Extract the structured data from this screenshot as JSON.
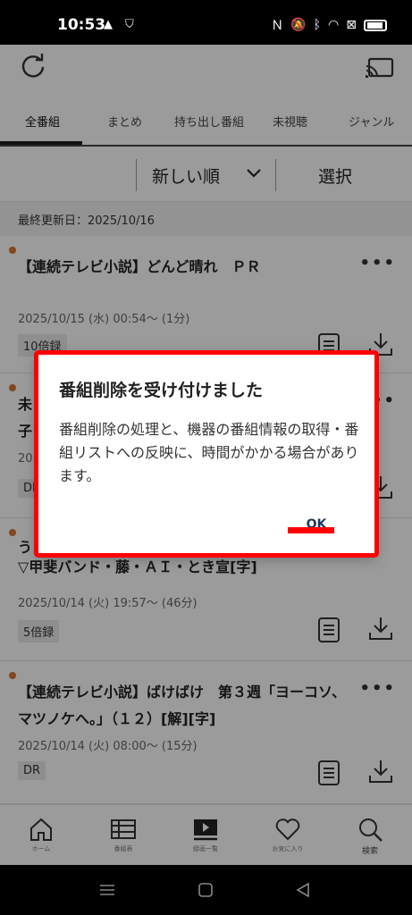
{
  "status": {
    "time": "10:53"
  },
  "tabs": [
    "全番組",
    "まとめ",
    "持ち出し番組",
    "未視聴",
    "ジャンル"
  ],
  "sort": {
    "label": "新しい順",
    "select_label": "選択"
  },
  "updated": "最終更新日：2025/10/16",
  "rows": [
    {
      "title": "【連続テレビ小説】どんど晴れ　ＰＲ",
      "date": "2025/10/15 (水) 00:54～ (1分)",
      "badge": "10倍録"
    },
    {
      "title": "未",
      "title2": "子",
      "date": "20",
      "badge": "DI"
    },
    {
      "title": "う",
      "title2": "▽甲斐バンド・藤・ＡＩ・とき宣[字]",
      "date": "2025/10/14 (火) 19:57～ (46分)",
      "badge": "5倍録"
    },
    {
      "title": "【連続テレビ小説】ばけばけ　第３週「ヨーコソ、マツノケへ。」（１２）[解][字]",
      "date": "2025/10/14 (火) 08:00～ (15分)",
      "badge": "DR"
    }
  ],
  "nav": [
    {
      "label": "ホーム",
      "icon": "home-icon"
    },
    {
      "label": "番組表",
      "icon": "program-guide-icon"
    },
    {
      "label": "録画一覧",
      "icon": "recordings-icon"
    },
    {
      "label": "お気に入り",
      "icon": "heart-icon"
    },
    {
      "label": "検索",
      "icon": "search-icon"
    }
  ],
  "dialog": {
    "title": "番組削除を受け付けました",
    "message": "番組削除の処理と、機器の番組情報の取得・番組リストへの反映に、時間がかかる場合があります。",
    "ok_label": "OK"
  },
  "colors": {
    "accent_dot": "#d4732f",
    "highlight": "#ff0000",
    "ok_text": "#1e3a5f"
  }
}
